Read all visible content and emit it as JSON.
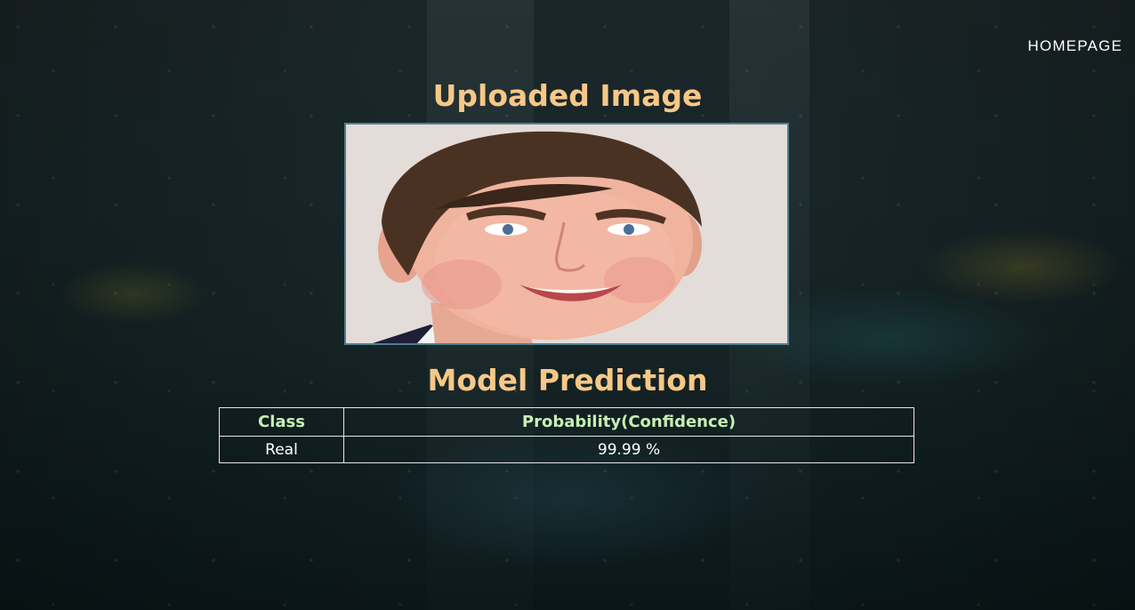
{
  "nav": {
    "homepage_label": "HOMEPAGE"
  },
  "upload": {
    "heading": "Uploaded Image"
  },
  "prediction": {
    "heading": "Model Prediction",
    "columns": [
      "Class",
      "Probability(Confidence)"
    ],
    "rows": [
      {
        "class": "Real",
        "probability": "99.99 %"
      }
    ]
  },
  "colors": {
    "heading": "#f6c887",
    "table_header": "#c7efb2",
    "image_border": "#4e7f8c"
  }
}
